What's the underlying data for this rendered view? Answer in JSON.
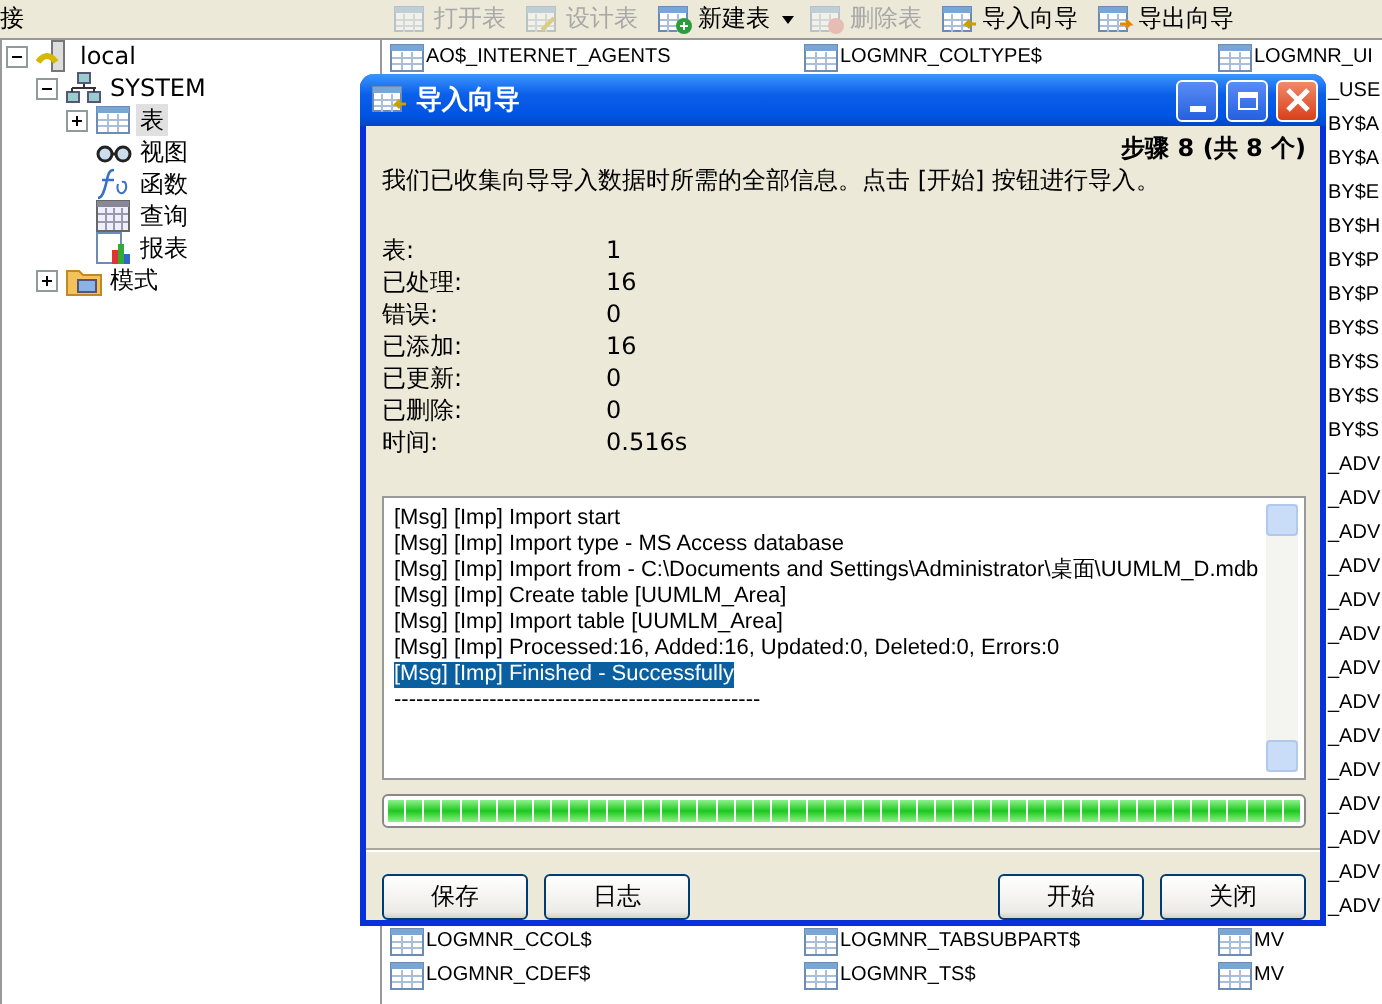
{
  "panel_title": "接",
  "toolbar": [
    {
      "label": "打开表",
      "kind": "open",
      "disabled": true,
      "dropdown": false
    },
    {
      "label": "设计表",
      "kind": "design",
      "disabled": true,
      "dropdown": false
    },
    {
      "label": "新建表",
      "kind": "new",
      "disabled": false,
      "dropdown": true
    },
    {
      "label": "删除表",
      "kind": "delete",
      "disabled": true,
      "dropdown": false
    },
    {
      "label": "导入向导",
      "kind": "import",
      "disabled": false,
      "dropdown": false
    },
    {
      "label": "导出向导",
      "kind": "export",
      "disabled": false,
      "dropdown": false
    }
  ],
  "tree": [
    {
      "label": "local",
      "kind": "server",
      "expandable": true,
      "expanded": true,
      "selected": false,
      "children": [
        {
          "label": "SYSTEM",
          "kind": "schema",
          "expandable": true,
          "expanded": true,
          "selected": false,
          "children": [
            {
              "label": "表",
              "kind": "table",
              "expandable": true,
              "expanded": false,
              "selected": true
            },
            {
              "label": "视图",
              "kind": "view",
              "expandable": false,
              "expanded": false,
              "selected": false
            },
            {
              "label": "函数",
              "kind": "function",
              "expandable": false,
              "expanded": false,
              "selected": false
            },
            {
              "label": "查询",
              "kind": "query",
              "expandable": false,
              "expanded": false,
              "selected": false
            },
            {
              "label": "报表",
              "kind": "report",
              "expandable": false,
              "expanded": false,
              "selected": false
            }
          ]
        },
        {
          "label": "模式",
          "kind": "folder",
          "expandable": true,
          "expanded": false,
          "selected": false
        }
      ]
    }
  ],
  "table_list": {
    "column_1": {
      "top": [
        "AO$_INTERNET_AGENTS"
      ],
      "bottom": [
        "LOGMNR_CCOL$",
        "LOGMNR_CDEF$"
      ]
    },
    "column_2": {
      "top": [
        "LOGMNR_COLTYPE$"
      ],
      "bottom": [
        "LOGMNR_TABSUBPART$",
        "LOGMNR_TS$"
      ]
    },
    "column_3": {
      "top": [
        "LOGMNR_UI"
      ],
      "beside_dialog": [
        "_USE",
        "BY$A",
        "BY$A",
        "BY$E",
        "BY$H",
        "BY$P",
        "BY$P",
        "BY$S",
        "BY$S",
        "BY$S",
        "BY$S",
        "_ADV",
        "_ADV",
        "_ADV",
        "_ADV",
        "_ADV",
        "_ADV",
        "_ADV",
        "_ADV",
        "_ADV",
        "_ADV",
        "_ADV",
        "_ADV",
        "_ADV",
        "_ADV"
      ],
      "bottom": [
        "MV",
        "MV"
      ]
    }
  },
  "dialog": {
    "title": "导入向导",
    "step": "步骤 8 (共 8 个)",
    "description": "我们已收集向导导入数据时所需的全部信息。点击 [开始] 按钮进行导入。",
    "stats": [
      {
        "label": "表:",
        "value": "1"
      },
      {
        "label": "已处理:",
        "value": "16"
      },
      {
        "label": "错误:",
        "value": "0"
      },
      {
        "label": "已添加:",
        "value": "16"
      },
      {
        "label": "已更新:",
        "value": "0"
      },
      {
        "label": "已删除:",
        "value": "0"
      },
      {
        "label": "时间:",
        "value": "0.516s"
      }
    ],
    "log": [
      {
        "text": "[Msg] [Imp] Import start",
        "selected": false
      },
      {
        "text": "[Msg] [Imp] Import type - MS Access database",
        "selected": false
      },
      {
        "text": "[Msg] [Imp] Import from - C:\\Documents and Settings\\Administrator\\桌面\\UUMLM_D.mdb",
        "selected": false
      },
      {
        "text": "[Msg] [Imp] Create table [UUMLM_Area]",
        "selected": false
      },
      {
        "text": "[Msg] [Imp] Import table [UUMLM_Area]",
        "selected": false
      },
      {
        "text": "[Msg] [Imp] Processed:16, Added:16, Updated:0, Deleted:0, Errors:0",
        "selected": false
      },
      {
        "text": "[Msg] [Imp] Finished - Successfully",
        "selected": true
      },
      {
        "text": "--------------------------------------------------",
        "selected": false
      }
    ],
    "progress": {
      "level": 1
    },
    "buttons_left": [
      "保存",
      "日志"
    ],
    "buttons_right": [
      "开始",
      "关闭"
    ]
  }
}
